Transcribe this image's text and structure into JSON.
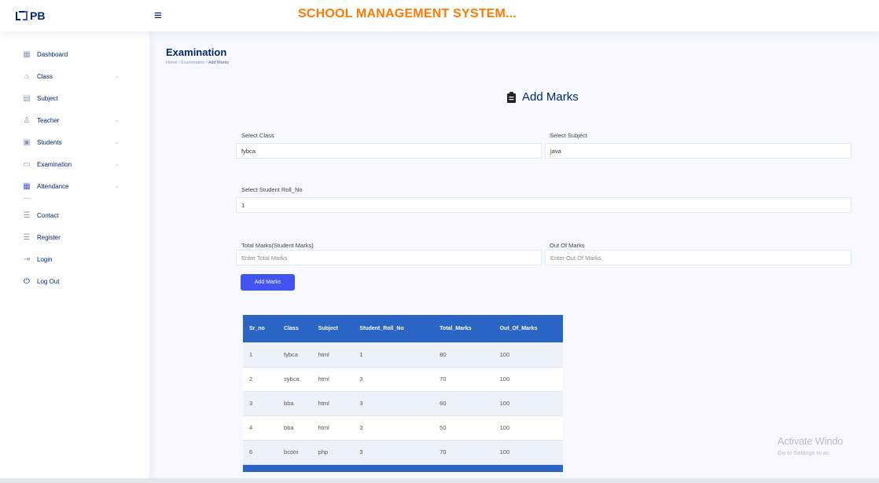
{
  "header": {
    "logo_text": "PB",
    "app_title": "SCHOOL MANAGEMENT SYSTEM..."
  },
  "sidebar": {
    "items": [
      {
        "label": "Dashboard",
        "icon": "grid-icon",
        "chevron": false
      },
      {
        "label": "Class",
        "icon": "class-icon",
        "chevron": true
      },
      {
        "label": "Subject",
        "icon": "subject-icon",
        "chevron": false
      },
      {
        "label": "Teacher",
        "icon": "teacher-icon",
        "chevron": true
      },
      {
        "label": "Students",
        "icon": "students-icon",
        "chevron": true
      },
      {
        "label": "Examination",
        "icon": "examination-icon",
        "chevron": true
      },
      {
        "label": "Attendance",
        "icon": "attendance-icon",
        "chevron": true
      },
      {
        "label": "Contact",
        "icon": "contact-icon",
        "chevron": false
      },
      {
        "label": "Register",
        "icon": "register-icon",
        "chevron": false
      },
      {
        "label": "Login",
        "icon": "login-icon",
        "chevron": false
      },
      {
        "label": "Log Out",
        "icon": "logout-icon",
        "chevron": false
      }
    ]
  },
  "page": {
    "title": "Examination",
    "breadcrumb": [
      "Home",
      "Examination",
      "Add Marks"
    ]
  },
  "form": {
    "heading": "Add Marks",
    "class_label": "Select Class",
    "class_value": "fybca",
    "subject_label": "Select Subject",
    "subject_value": "java",
    "roll_label": "Select Student Roll_No",
    "roll_value": "1",
    "total_label": "Total Marks(Student Marks)",
    "total_placeholder": "Enter Total Marks",
    "out_label": "Out Of Marks",
    "out_placeholder": "Enter Out Of Marks",
    "submit_label": "Add Marks"
  },
  "table": {
    "headers": [
      "Sr_no",
      "Class",
      "Subject",
      "Student_Roll_No",
      "Total_Marks",
      "Out_Of_Marks"
    ],
    "rows": [
      [
        "1",
        "fybca",
        "html",
        "1",
        "80",
        "100"
      ],
      [
        "2",
        "sybca",
        "html",
        "3",
        "70",
        "100"
      ],
      [
        "3",
        "bba",
        "html",
        "3",
        "60",
        "100"
      ],
      [
        "4",
        "bba",
        "html",
        "3",
        "50",
        "100"
      ],
      [
        "6",
        "bcom",
        "php",
        "3",
        "70",
        "100"
      ]
    ]
  },
  "watermark": {
    "line1": "Activate Windo",
    "line2": "Go to Settings to ac"
  },
  "colors": {
    "brand_navy": "#012970",
    "title_orange": "#ff7a00",
    "primary_button": "#4154f1",
    "table_header": "#2a65c6"
  }
}
